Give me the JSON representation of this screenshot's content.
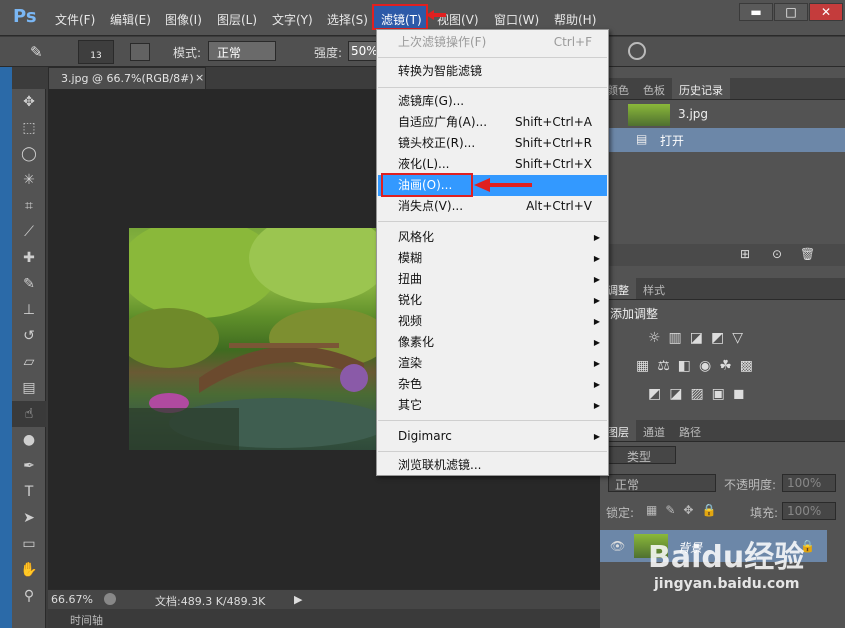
{
  "app": {
    "logo": "Ps"
  },
  "menubar": {
    "items": [
      "文件(F)",
      "编辑(E)",
      "图像(I)",
      "图层(L)",
      "文字(Y)",
      "选择(S)",
      "滤镜(T)",
      "视图(V)",
      "窗口(W)",
      "帮助(H)"
    ],
    "highlighted": "滤镜(T)"
  },
  "window_controls": {
    "minimize": "▬",
    "restore": "□",
    "close": "✕"
  },
  "options_bar": {
    "brush_size": "13",
    "mode_label": "模式:",
    "mode_value": "正常",
    "strength_label": "强度:",
    "strength_value": "50%"
  },
  "document": {
    "tab_title": "3.jpg @ 66.7%(RGB/8#)",
    "close": "×"
  },
  "status": {
    "zoom": "66.67%",
    "doc_info": "文档:489.3 K/489.3K"
  },
  "timeline": {
    "label": "时间轴"
  },
  "filter_menu": {
    "items": [
      {
        "label": "上次滤镜操作(F)",
        "shortcut": "Ctrl+F",
        "disabled": true
      },
      {
        "label": "转换为智能滤镜"
      },
      {
        "label": "滤镜库(G)..."
      },
      {
        "label": "自适应广角(A)...",
        "shortcut": "Shift+Ctrl+A"
      },
      {
        "label": "镜头校正(R)...",
        "shortcut": "Shift+Ctrl+R"
      },
      {
        "label": "液化(L)...",
        "shortcut": "Shift+Ctrl+X"
      },
      {
        "label": "油画(O)...",
        "highlighted": true
      },
      {
        "label": "消失点(V)...",
        "shortcut": "Alt+Ctrl+V"
      },
      {
        "label": "风格化",
        "submenu": true
      },
      {
        "label": "模糊",
        "submenu": true
      },
      {
        "label": "扭曲",
        "submenu": true
      },
      {
        "label": "锐化",
        "submenu": true
      },
      {
        "label": "视频",
        "submenu": true
      },
      {
        "label": "像素化",
        "submenu": true
      },
      {
        "label": "渲染",
        "submenu": true
      },
      {
        "label": "杂色",
        "submenu": true
      },
      {
        "label": "其它",
        "submenu": true
      },
      {
        "label": "Digimarc",
        "submenu": true
      },
      {
        "label": "浏览联机滤镜..."
      }
    ]
  },
  "history_panel": {
    "tabs": [
      "颜色",
      "色板",
      "历史记录"
    ],
    "snapshot": "3.jpg",
    "step": "打开"
  },
  "adjust_panel": {
    "tabs": [
      "调整",
      "样式"
    ],
    "title": "添加调整"
  },
  "layers_panel": {
    "tabs": [
      "图层",
      "通道",
      "路径"
    ],
    "kind_label": "类型",
    "blend": "正常",
    "opacity_label": "不透明度:",
    "opacity_value": "100%",
    "lock_label": "锁定:",
    "fill_label": "填充:",
    "fill_value": "100%",
    "layer_name": "背景"
  },
  "watermark": {
    "text": "Baidu经验",
    "url": "jingyan.baidu.com"
  },
  "colors": {
    "accent": "#3399ff",
    "annotation": "#e02020"
  }
}
